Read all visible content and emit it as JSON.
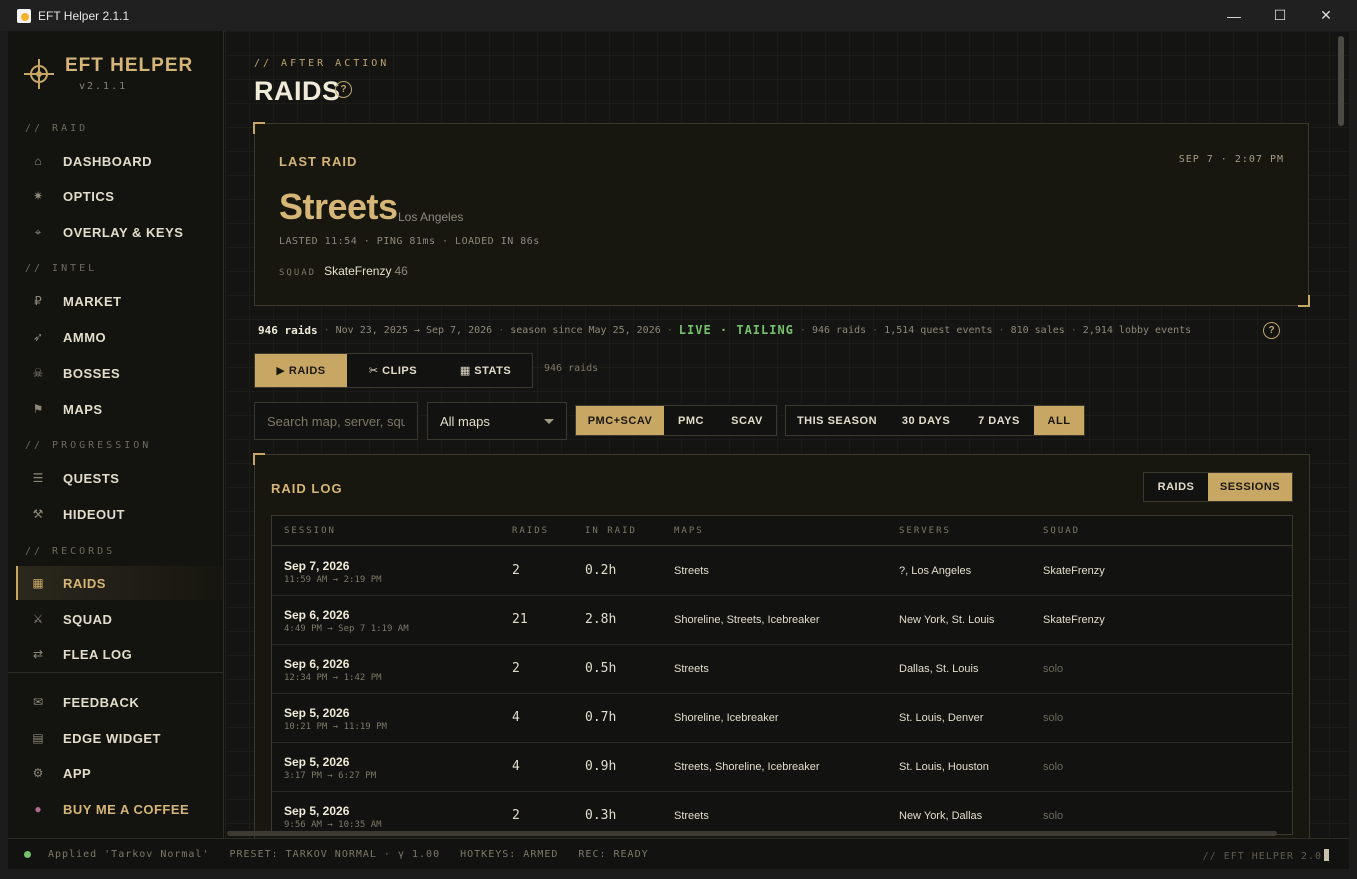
{
  "window": {
    "title": "EFT Helper 2.1.1",
    "minimize": "—",
    "maximize": "☐",
    "close": "✕"
  },
  "brand": {
    "name": "EFT HELPER",
    "version": "v2.1.1"
  },
  "sidebar": {
    "sections": {
      "raid": "// RAID",
      "intel": "// INTEL",
      "progression": "// PROGRESSION",
      "records": "// RECORDS"
    },
    "items": [
      {
        "label": "DASHBOARD",
        "icon": "⌂"
      },
      {
        "label": "OPTICS",
        "icon": "✷"
      },
      {
        "label": "OVERLAY & KEYS",
        "icon": "⌖"
      },
      {
        "label": "MARKET",
        "icon": "₽"
      },
      {
        "label": "AMMO",
        "icon": "➶"
      },
      {
        "label": "BOSSES",
        "icon": "☠"
      },
      {
        "label": "MAPS",
        "icon": "⚑"
      },
      {
        "label": "QUESTS",
        "icon": "☰"
      },
      {
        "label": "HIDEOUT",
        "icon": "⚒"
      },
      {
        "label": "RAIDS",
        "icon": "▦"
      },
      {
        "label": "SQUAD",
        "icon": "⚔"
      },
      {
        "label": "FLEA LOG",
        "icon": "⇄"
      },
      {
        "label": "FEEDBACK",
        "icon": "✉"
      },
      {
        "label": "EDGE WIDGET",
        "icon": "▤"
      },
      {
        "label": "APP",
        "icon": "⚙"
      },
      {
        "label": "BUY ME A COFFEE",
        "icon": "●"
      }
    ]
  },
  "page": {
    "kicker": "// AFTER ACTION",
    "title": "RAIDS",
    "help": "?"
  },
  "last_raid": {
    "label": "LAST RAID",
    "time": "SEP 7 · 2:07 PM",
    "map": "Streets",
    "region": "Los Angeles",
    "meta": "LASTED 11:54 · PING 81ms · LOADED IN 86s",
    "squad_label": "SQUAD",
    "squad_name": "SkateFrenzy",
    "squad_level": "46"
  },
  "stats": {
    "count": "946 raids",
    "range": "Nov 23, 2025 → Sep 7, 2026",
    "season": "season since May 25, 2026",
    "live": "LIVE · TAILING",
    "raids": "946 raids",
    "quest_events": "1,514 quest events",
    "sales": "810 sales",
    "lobby_events": "2,914 lobby events"
  },
  "tabs": {
    "raids": "▶ RAIDS",
    "clips": "✂ CLIPS",
    "stats": "▦ STATS",
    "count": "946 raids"
  },
  "filters": {
    "search_placeholder": "Search map, server, squadmate...",
    "map_select": "All maps",
    "mode": [
      "PMC+SCAV",
      "PMC",
      "SCAV"
    ],
    "period": [
      "THIS SEASON",
      "30 DAYS",
      "7 DAYS",
      "ALL"
    ]
  },
  "raid_log": {
    "title": "RAID LOG",
    "view_raids": "RAIDS",
    "view_sessions": "SESSIONS",
    "headers": {
      "session": "SESSION",
      "raids": "RAIDS",
      "in_raid": "IN RAID",
      "maps": "MAPS",
      "servers": "SERVERS",
      "squad": "SQUAD"
    },
    "rows": [
      {
        "date": "Sep 7, 2026",
        "range": "11:59 AM → 2:19 PM",
        "raids": "2",
        "in_raid": "0.2h",
        "maps": "Streets",
        "servers": "?, Los Angeles",
        "squad": "SkateFrenzy"
      },
      {
        "date": "Sep 6, 2026",
        "range": "4:49 PM → Sep 7 1:19 AM",
        "raids": "21",
        "in_raid": "2.8h",
        "maps": "Shoreline, Streets, Icebreaker",
        "servers": "New York, St. Louis",
        "squad": "SkateFrenzy"
      },
      {
        "date": "Sep 6, 2026",
        "range": "12:34 PM → 1:42 PM",
        "raids": "2",
        "in_raid": "0.5h",
        "maps": "Streets",
        "servers": "Dallas, St. Louis",
        "squad": "solo"
      },
      {
        "date": "Sep 5, 2026",
        "range": "10:21 PM → 11:19 PM",
        "raids": "4",
        "in_raid": "0.7h",
        "maps": "Shoreline, Icebreaker",
        "servers": "St. Louis, Denver",
        "squad": "solo"
      },
      {
        "date": "Sep 5, 2026",
        "range": "3:17 PM → 6:27 PM",
        "raids": "4",
        "in_raid": "0.9h",
        "maps": "Streets, Shoreline, Icebreaker",
        "servers": "St. Louis, Houston",
        "squad": "solo"
      },
      {
        "date": "Sep 5, 2026",
        "range": "9:56 AM → 10:35 AM",
        "raids": "2",
        "in_raid": "0.3h",
        "maps": "Streets",
        "servers": "New York, Dallas",
        "squad": "solo"
      }
    ]
  },
  "statusbar": {
    "applied": "Applied 'Tarkov Normal'",
    "preset": "PRESET: TARKOV NORMAL · γ 1.00",
    "hotkeys": "HOTKEYS: ARMED",
    "rec": "REC: READY",
    "brand": "// EFT HELPER 2.0"
  }
}
